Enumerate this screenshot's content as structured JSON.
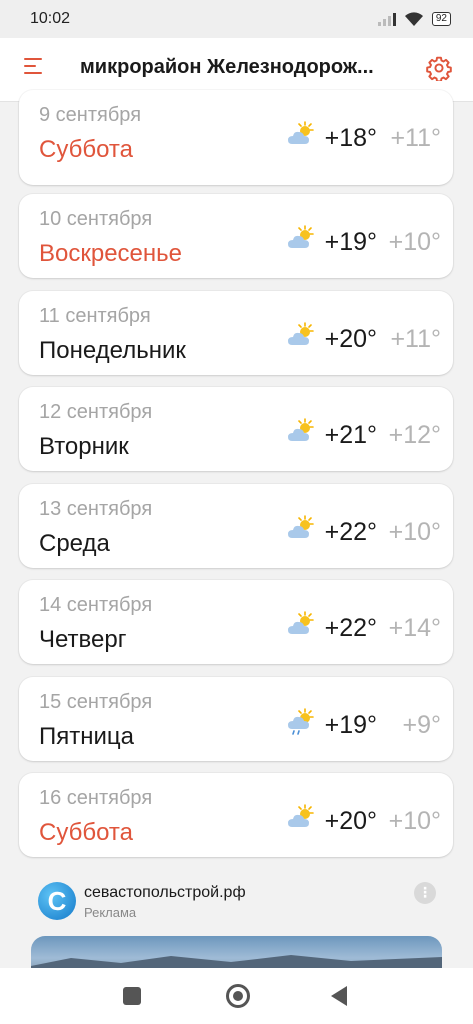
{
  "status_bar": {
    "time": "10:02",
    "battery": "92"
  },
  "header": {
    "location": "микрорайон Железнодорож...",
    "menu_icon": "menu-icon",
    "settings_icon": "gear-icon",
    "accent_color": "#e0553b"
  },
  "days": [
    {
      "date": "9 сентября",
      "name": "Суббота",
      "weekend": true,
      "icon": "partly-cloudy-icon",
      "t_day": "+18°",
      "t_night": "+11°"
    },
    {
      "date": "10 сентября",
      "name": "Воскресенье",
      "weekend": true,
      "icon": "partly-cloudy-icon",
      "t_day": "+19°",
      "t_night": "+10°"
    },
    {
      "date": "11 сентября",
      "name": "Понедельник",
      "weekend": false,
      "icon": "partly-cloudy-icon",
      "t_day": "+20°",
      "t_night": "+11°"
    },
    {
      "date": "12 сентября",
      "name": "Вторник",
      "weekend": false,
      "icon": "partly-cloudy-icon",
      "t_day": "+21°",
      "t_night": "+12°"
    },
    {
      "date": "13 сентября",
      "name": "Среда",
      "weekend": false,
      "icon": "partly-cloudy-icon",
      "t_day": "+22°",
      "t_night": "+10°"
    },
    {
      "date": "14 сентября",
      "name": "Четверг",
      "weekend": false,
      "icon": "partly-cloudy-icon",
      "t_day": "+22°",
      "t_night": "+14°"
    },
    {
      "date": "15 сентября",
      "name": "Пятница",
      "weekend": false,
      "icon": "partly-cloudy-rain-icon",
      "t_day": "+19°",
      "t_night": "+9°"
    },
    {
      "date": "16 сентября",
      "name": "Суббота",
      "weekend": true,
      "icon": "partly-cloudy-icon",
      "t_day": "+20°",
      "t_night": "+10°"
    }
  ],
  "ad": {
    "logo_letter": "С",
    "title": "севастопольстрой.рф",
    "label": "Реклама",
    "more_icon": "more-vertical-icon"
  },
  "nav": {
    "recent_icon": "recent-apps-icon",
    "home_icon": "home-icon",
    "back_icon": "back-icon"
  }
}
